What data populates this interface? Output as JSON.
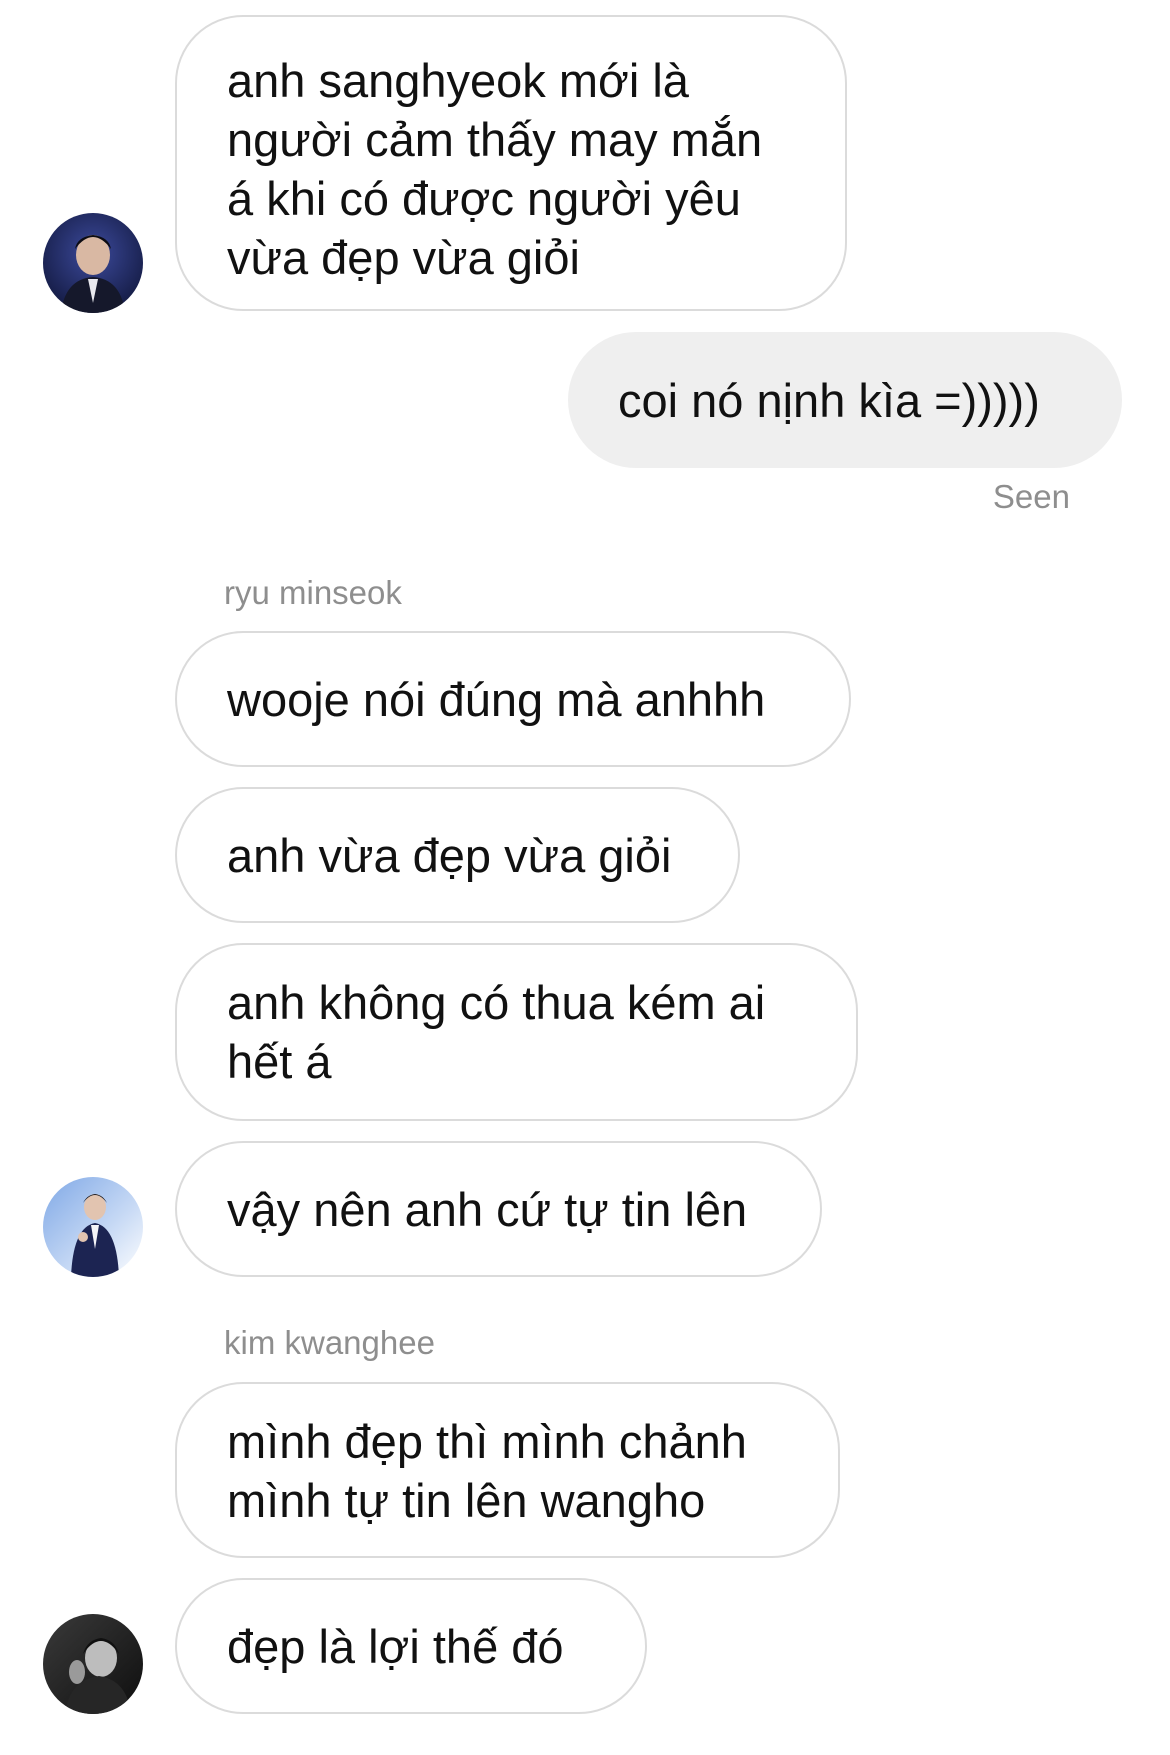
{
  "thread": {
    "block1": {
      "messages": [
        "anh sanghyeok mới là người cảm thấy may mắn á khi có được người yêu vừa đẹp vừa giỏi"
      ],
      "avatar_icon": "user-avatar-1"
    },
    "outgoing": {
      "text": "coi nó nịnh kìa =)))))",
      "status": "Seen"
    },
    "block2": {
      "sender": "ryu minseok",
      "messages": [
        "wooje nói đúng mà anhhh",
        "anh vừa đẹp vừa giỏi",
        "anh không có thua kém ai hết á",
        "vậy nên anh cứ tự tin lên"
      ],
      "avatar_icon": "user-avatar-2"
    },
    "block3": {
      "sender": "kim kwanghee",
      "messages": [
        "mình đẹp thì mình chảnh mình tự tin lên wangho",
        "đẹp là lợi thế đó"
      ],
      "avatar_icon": "user-avatar-3"
    }
  },
  "colors": {
    "incoming_border": "#dbdbdb",
    "outgoing_bg": "#efefef",
    "meta_text": "#8e8e8e"
  }
}
